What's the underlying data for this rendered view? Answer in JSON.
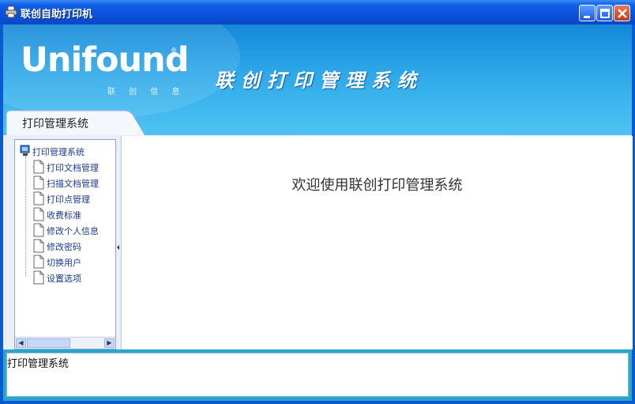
{
  "window": {
    "title": "联创自助打印机",
    "controls": [
      "minimize-icon",
      "maximize-icon",
      "close-icon"
    ]
  },
  "banner": {
    "logo_text": "Unifound",
    "logo_registered": "®",
    "logo_subtitle": "联 创 信 息",
    "title": "联创打印管理系统"
  },
  "tab": {
    "label": "打印管理系统"
  },
  "tree": {
    "root": "打印管理系统",
    "items": [
      "打印文档管理",
      "扫描文档管理",
      "打印点管理",
      "收费标准",
      "修改个人信息",
      "修改密码",
      "切换用户",
      "设置选项"
    ]
  },
  "main": {
    "welcome": "欢迎使用联创打印管理系统"
  },
  "status": {
    "text": "打印管理系统"
  },
  "colors": {
    "titlebar": "#0a4fd8",
    "banner": "#28a2e6",
    "status_frame": "#2aa6c8",
    "tree_text": "#1a3a8a"
  }
}
